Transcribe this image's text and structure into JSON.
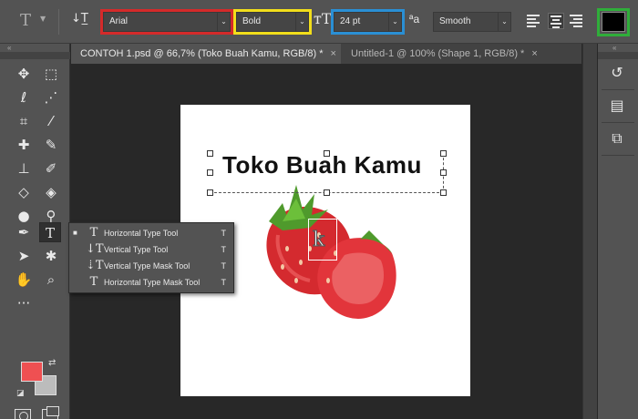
{
  "options_bar": {
    "tool_icon": "type-tool-icon",
    "orientation_icon": "toggle-orientation-icon",
    "font_family": "Arial",
    "font_style": "Bold",
    "font_size": "24 pt",
    "antialias_method": "Smooth",
    "alignment_icons": [
      "align-left-icon",
      "align-center-icon",
      "align-right-icon"
    ],
    "text_color": "#000000"
  },
  "highlights": {
    "font_family": "#d42a2a",
    "font_style": "#f2de1b",
    "font_size": "#2a8fd4",
    "text_color": "#2fae3a"
  },
  "tabs": [
    {
      "label": "CONTOH 1.psd @ 66,7% (Toko Buah Kamu, RGB/8) *",
      "close": "×"
    },
    {
      "label": "Untitled-1 @ 100% (Shape 1, RGB/8) *",
      "close": "×"
    }
  ],
  "canvas": {
    "text_layer": "Toko Buah Kamu",
    "image": "strawberry"
  },
  "tools": [
    "move-icon",
    "marquee-icon",
    "lasso-icon",
    "quick-selection-icon",
    "crop-icon",
    "eyedropper-icon",
    "healing-brush-icon",
    "brush-icon",
    "clone-stamp-icon",
    "history-brush-icon",
    "eraser-icon",
    "paint-bucket-icon",
    "blur-icon",
    "dodge-icon",
    "pen-icon",
    "type-icon",
    "path-selection-icon",
    "custom-shape-icon",
    "hand-icon",
    "zoom-icon",
    "more-tools-icon"
  ],
  "colors": {
    "foreground": "#ef5052",
    "background": "#bcbcbc"
  },
  "type_flyout": {
    "items": [
      {
        "label": "Horizontal Type Tool",
        "shortcut": "T",
        "selected": true
      },
      {
        "label": "Vertical Type Tool",
        "shortcut": "T",
        "selected": false
      },
      {
        "label": "Vertical Type Mask Tool",
        "shortcut": "T",
        "selected": false
      },
      {
        "label": "Horizontal Type Mask Tool",
        "shortcut": "T",
        "selected": false
      }
    ]
  },
  "right_panel": {
    "icons": [
      "history-icon",
      "properties-icon",
      "layers-icon"
    ]
  }
}
